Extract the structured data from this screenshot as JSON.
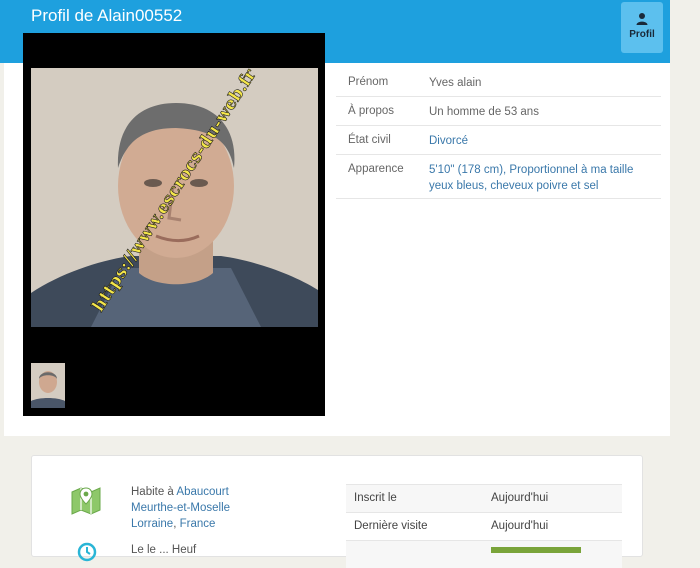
{
  "header": {
    "title": "Profil de Alain00552",
    "profil_label": "Profil"
  },
  "photo": {
    "watermark": "https://www.escrocs-du-web.fr"
  },
  "info": {
    "rows": [
      {
        "key": "Prénom",
        "value": "Yves alain"
      },
      {
        "key": "À propos",
        "value": "Un homme de 53 ans"
      },
      {
        "key": "État civil",
        "value": "Divorcé"
      },
      {
        "key": "Apparence",
        "value": "5'10\" (178 cm), Proportionnel à ma taille yeux bleus, cheveux poivre et sel"
      }
    ]
  },
  "location": {
    "prefix": "Habite à ",
    "city": "Abaucourt",
    "department": "Meurthe-et-Moselle",
    "region": "Lorraine",
    "separator": ", ",
    "country": "France",
    "cut_text": "Le le  ...  Heuf"
  },
  "stats": [
    {
      "key": "Inscrit le",
      "value": "Aujourd'hui"
    },
    {
      "key": "Dernière visite",
      "value": "Aujourd'hui"
    }
  ],
  "colors": {
    "header": "#1ea0de",
    "link": "#3a78aa",
    "tab": "#5cc0ee"
  }
}
